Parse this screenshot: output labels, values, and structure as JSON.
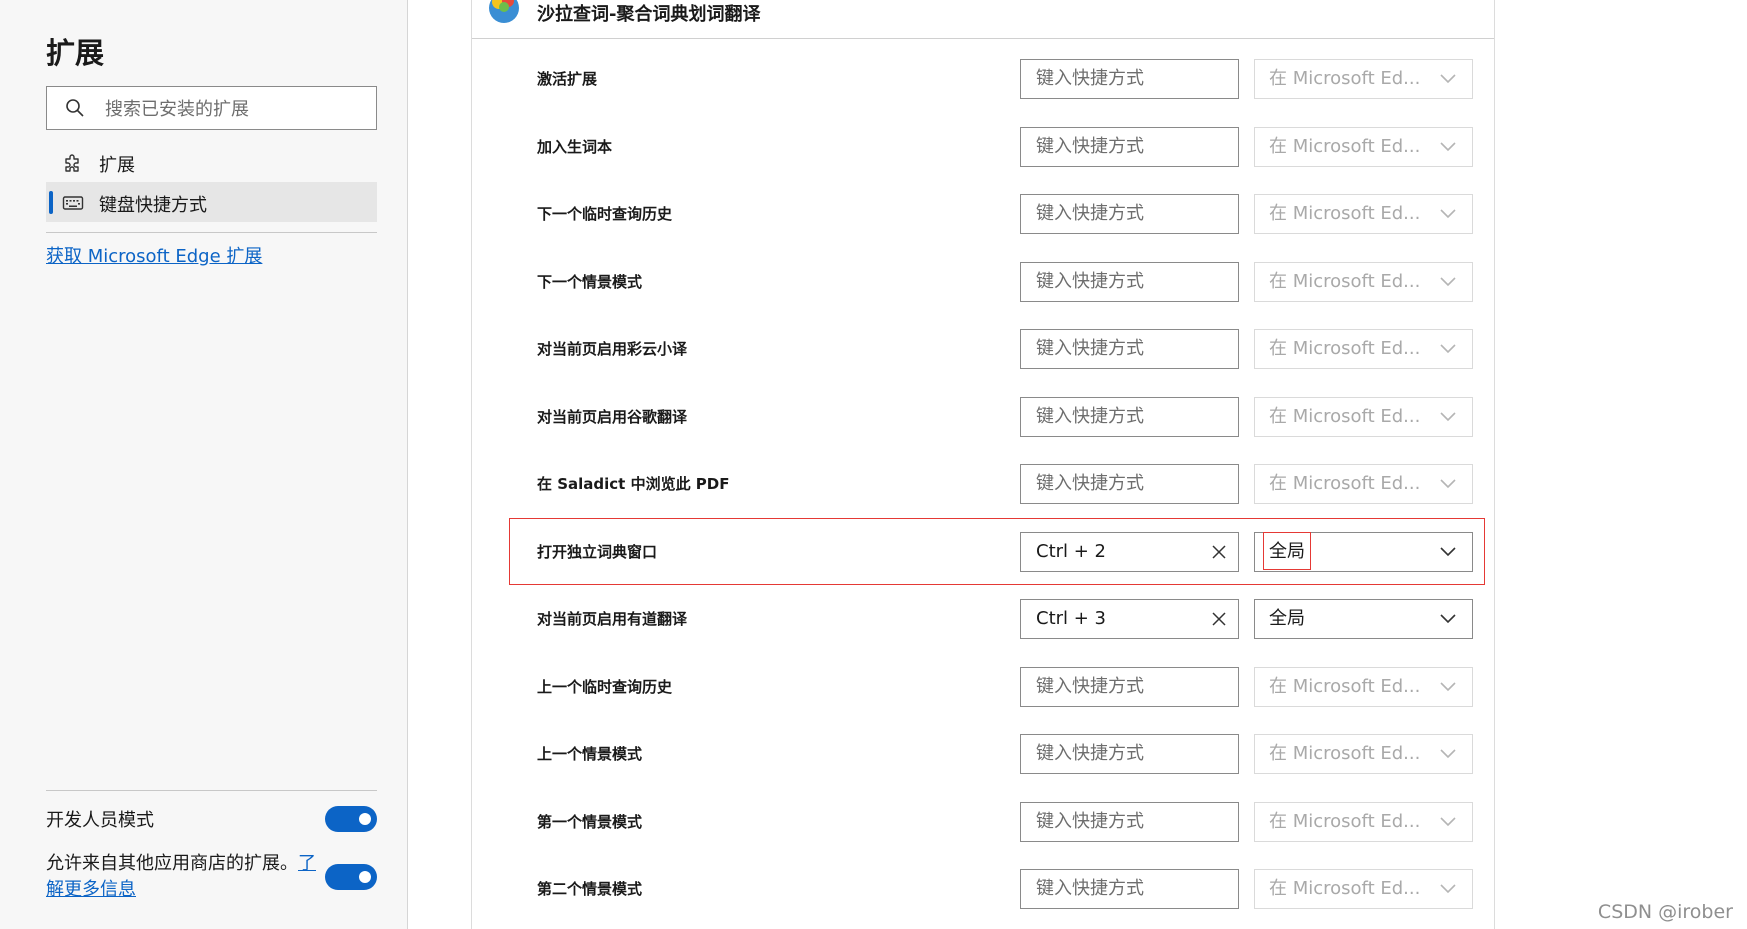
{
  "sidebar": {
    "title": "扩展",
    "search_placeholder": "搜索已安装的扩展",
    "nav": [
      {
        "label": "扩展",
        "icon": "puzzle-icon",
        "active": false
      },
      {
        "label": "键盘快捷方式",
        "icon": "keyboard-icon",
        "active": true
      }
    ],
    "get_extensions_link": "获取 Microsoft Edge 扩展",
    "developer_mode_label": "开发人员模式",
    "developer_mode_on": true,
    "allow_other_stores_text": "允许来自其他应用商店的扩展。",
    "learn_more_link": "了解更多信息",
    "allow_other_stores_on": true
  },
  "extension": {
    "name": "沙拉查词-聚合词典划词翻译",
    "icon": "saladict-logo"
  },
  "shortcut_placeholder": "键入快捷方式",
  "scope_default": "在 Microsoft Ed...",
  "rows": [
    {
      "label": "激活扩展",
      "shortcut": "",
      "scope": "在 Microsoft Ed..."
    },
    {
      "label": "加入生词本",
      "shortcut": "",
      "scope": "在 Microsoft Ed..."
    },
    {
      "label": "下一个临时查询历史",
      "shortcut": "",
      "scope": "在 Microsoft Ed..."
    },
    {
      "label": "下一个情景模式",
      "shortcut": "",
      "scope": "在 Microsoft Ed..."
    },
    {
      "label": "对当前页启用彩云小译",
      "shortcut": "",
      "scope": "在 Microsoft Ed..."
    },
    {
      "label": "对当前页启用谷歌翻译",
      "shortcut": "",
      "scope": "在 Microsoft Ed..."
    },
    {
      "label": "在 Saladict 中浏览此 PDF",
      "shortcut": "",
      "scope": "在 Microsoft Ed..."
    },
    {
      "label": "打开独立词典窗口",
      "shortcut": "Ctrl + 2",
      "scope": "全局"
    },
    {
      "label": "对当前页启用有道翻译",
      "shortcut": "Ctrl + 3",
      "scope": "全局"
    },
    {
      "label": "上一个临时查询历史",
      "shortcut": "",
      "scope": "在 Microsoft Ed..."
    },
    {
      "label": "上一个情景模式",
      "shortcut": "",
      "scope": "在 Microsoft Ed..."
    },
    {
      "label": "第一个情景模式",
      "shortcut": "",
      "scope": "在 Microsoft Ed..."
    },
    {
      "label": "第二个情景模式",
      "shortcut": "",
      "scope": "在 Microsoft Ed..."
    }
  ],
  "watermark": "CSDN @irober",
  "colors": {
    "accent": "#0c64c6",
    "highlight": "#e53935"
  }
}
